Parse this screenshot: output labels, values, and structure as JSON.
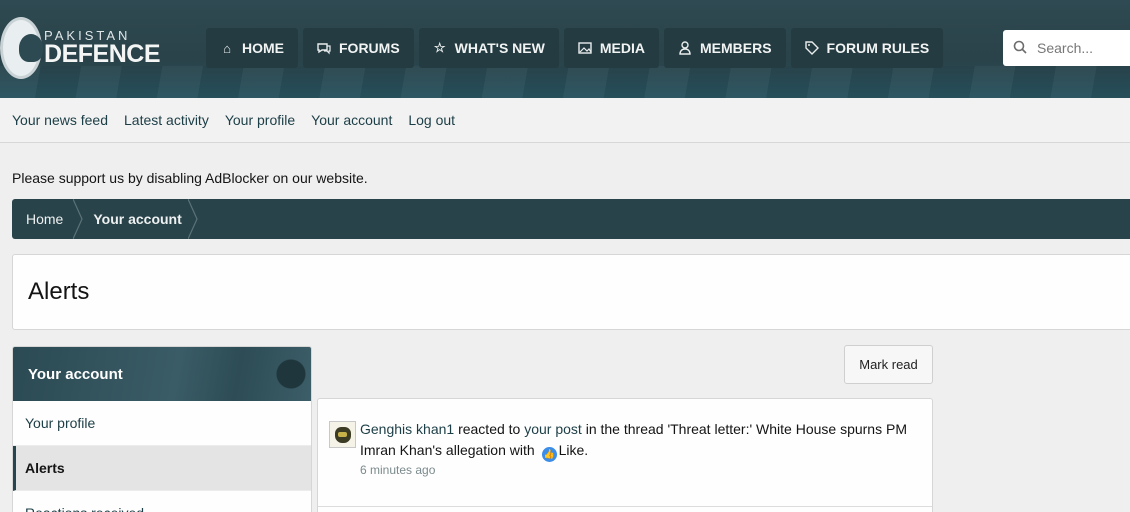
{
  "header": {
    "logo_line1": "PAKISTAN",
    "logo_line2": "DEFENCE",
    "nav": [
      {
        "label": "HOME",
        "icon": "home-icon"
      },
      {
        "label": "FORUMS",
        "icon": "comments-icon"
      },
      {
        "label": "WHAT'S NEW",
        "icon": "star-icon"
      },
      {
        "label": "MEDIA",
        "icon": "image-icon"
      },
      {
        "label": "MEMBERS",
        "icon": "user-icon"
      },
      {
        "label": "FORUM RULES",
        "icon": "tag-icon"
      }
    ],
    "search_placeholder": "Search..."
  },
  "subnav": {
    "items": [
      "Your news feed",
      "Latest activity",
      "Your profile",
      "Your account",
      "Log out"
    ]
  },
  "notice": "Please support us by disabling AdBlocker on our website.",
  "breadcrumb": {
    "items": [
      "Home",
      "Your account"
    ]
  },
  "page": {
    "title": "Alerts"
  },
  "sidebar": {
    "title": "Your account",
    "items": [
      "Your profile",
      "Alerts",
      "Reactions received"
    ],
    "active": "Alerts"
  },
  "content": {
    "mark_read": "Mark read",
    "alerts": [
      {
        "user": "Genghis khan1",
        "text_1": " reacted to ",
        "link": "your post",
        "text_2": " in the thread 'Threat letter:' White House spurns PM Imran Khan's allegation with ",
        "reaction": "Like.",
        "time": "6 minutes ago"
      }
    ]
  },
  "colors": {
    "header_bg": "#2f4a52",
    "accent": "#29434a",
    "link": "#1c3e46",
    "like": "#3b8de8"
  }
}
